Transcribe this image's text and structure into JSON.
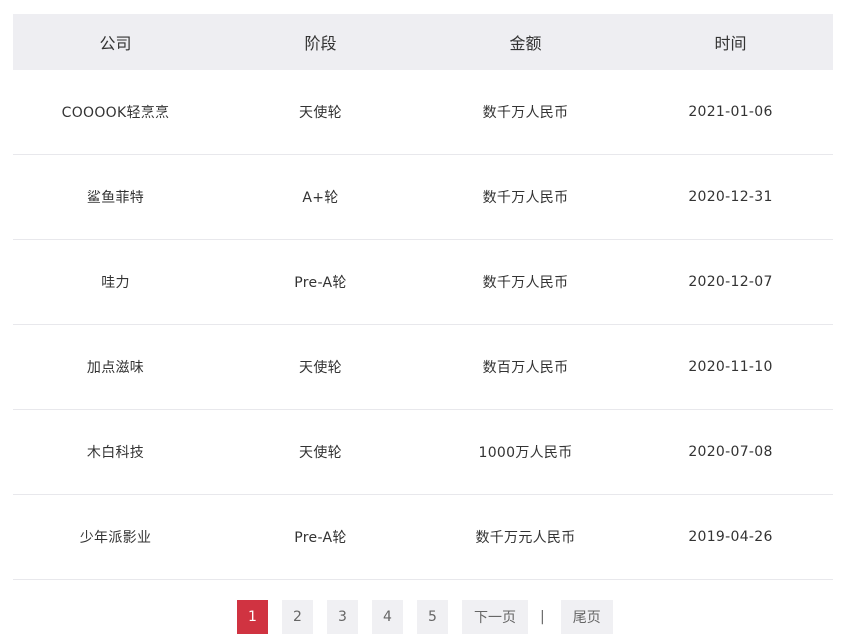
{
  "table": {
    "headers": [
      "公司",
      "阶段",
      "金额",
      "时间"
    ],
    "rows": [
      [
        "COOOOK轻烹烹",
        "天使轮",
        "数千万人民币",
        "2021-01-06"
      ],
      [
        "鲨鱼菲特",
        "A+轮",
        "数千万人民币",
        "2020-12-31"
      ],
      [
        "哇力",
        "Pre-A轮",
        "数千万人民币",
        "2020-12-07"
      ],
      [
        "加点滋味",
        "天使轮",
        "数百万人民币",
        "2020-11-10"
      ],
      [
        "木白科技",
        "天使轮",
        "1000万人民币",
        "2020-07-08"
      ],
      [
        "少年派影业",
        "Pre-A轮",
        "数千万元人民币",
        "2019-04-26"
      ]
    ]
  },
  "pagination": {
    "pages": [
      "1",
      "2",
      "3",
      "4",
      "5"
    ],
    "current": "1",
    "next_label": "下一页",
    "separator": "|",
    "last_label": "尾页"
  },
  "colors": {
    "header_bg": "#eeeef2",
    "active_page": "#d03341",
    "button_bg": "#f0f0f3"
  }
}
